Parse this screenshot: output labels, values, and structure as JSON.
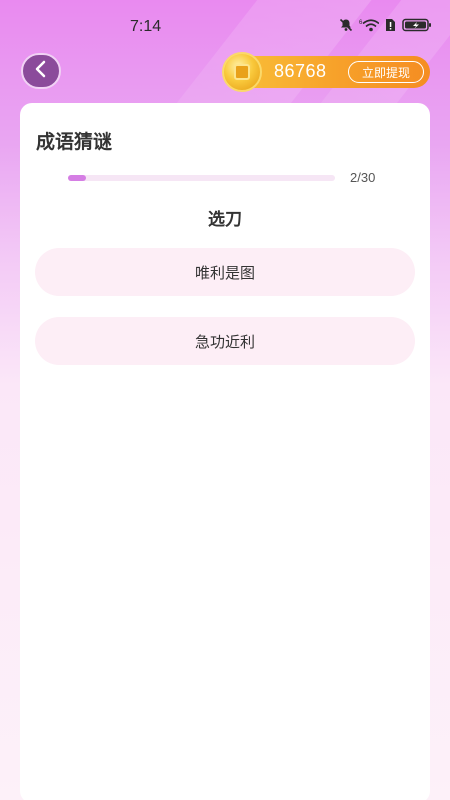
{
  "status_bar": {
    "time": "7:14"
  },
  "header": {
    "back_icon": "chevron-left-icon",
    "coins": "86768",
    "withdraw_label": "立即提现"
  },
  "quiz": {
    "title": "成语猜谜",
    "progress_text": "2/30",
    "progress_fraction": 0.0667,
    "question": "选刀",
    "options": [
      {
        "label": "唯利是图"
      },
      {
        "label": "急功近利"
      }
    ]
  },
  "colors": {
    "accent": "#d57ee4",
    "coin_orange": "#f7a12a",
    "option_bg": "#fdeef6"
  }
}
